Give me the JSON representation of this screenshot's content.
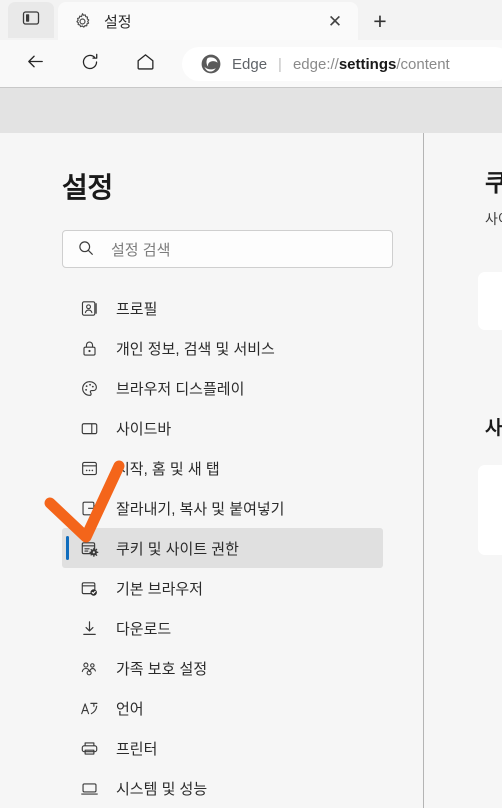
{
  "browser": {
    "tab_actions_icon": "tab-actions-icon",
    "tab": {
      "favicon": "gear-icon",
      "title": "설정",
      "close_label": "✕"
    },
    "new_tab_label": "+",
    "toolbar": {
      "back_icon": "back-arrow-icon",
      "refresh_icon": "refresh-icon",
      "home_icon": "home-icon"
    },
    "address": {
      "brand_icon": "edge-logo-icon",
      "brand_name": "Edge",
      "separator": "|",
      "url_scheme": "edge://",
      "url_bold": "settings",
      "url_rest": "/content"
    }
  },
  "settings": {
    "title": "설정",
    "search": {
      "icon": "search-icon",
      "placeholder": "설정 검색",
      "value": ""
    },
    "nav_items": [
      {
        "icon": "profile-icon",
        "label": "프로필",
        "selected": false
      },
      {
        "icon": "lock-icon",
        "label": "개인 정보, 검색 및 서비스",
        "selected": false
      },
      {
        "icon": "palette-icon",
        "label": "브라우저 디스플레이",
        "selected": false
      },
      {
        "icon": "sidebar-icon",
        "label": "사이드바",
        "selected": false
      },
      {
        "icon": "start-home-tab-icon",
        "label": "시작, 홈 및 새 탭",
        "selected": false
      },
      {
        "icon": "cut-copy-paste-icon",
        "label": "잘라내기, 복사 및 붙여넣기",
        "selected": false
      },
      {
        "icon": "cookies-icon",
        "label": "쿠키 및 사이트 권한",
        "selected": true
      },
      {
        "icon": "default-browser-icon",
        "label": "기본 브라우저",
        "selected": false
      },
      {
        "icon": "download-icon",
        "label": "다운로드",
        "selected": false
      },
      {
        "icon": "family-safety-icon",
        "label": "가족 보호 설정",
        "selected": false
      },
      {
        "icon": "language-icon",
        "label": "언어",
        "selected": false
      },
      {
        "icon": "printer-icon",
        "label": "프린터",
        "selected": false
      },
      {
        "icon": "system-icon",
        "label": "시스템 및 성능",
        "selected": false
      }
    ]
  },
  "content": {
    "title": "쿠키 및 사이트 권한",
    "subtitle": "사이트에서 쿠키를 사용할 수 있도록 허용",
    "section_heading": "사이트 권한"
  },
  "annotation": {
    "shape": "orange-checkmark",
    "color": "#f4651a"
  },
  "colors": {
    "accent_selected": "#0f6cbd",
    "selected_row_bg": "#e0e0e0",
    "page_bg": "#f6f6f6",
    "gray_band": "#e3e3e3",
    "annotation_orange": "#f4651a"
  }
}
